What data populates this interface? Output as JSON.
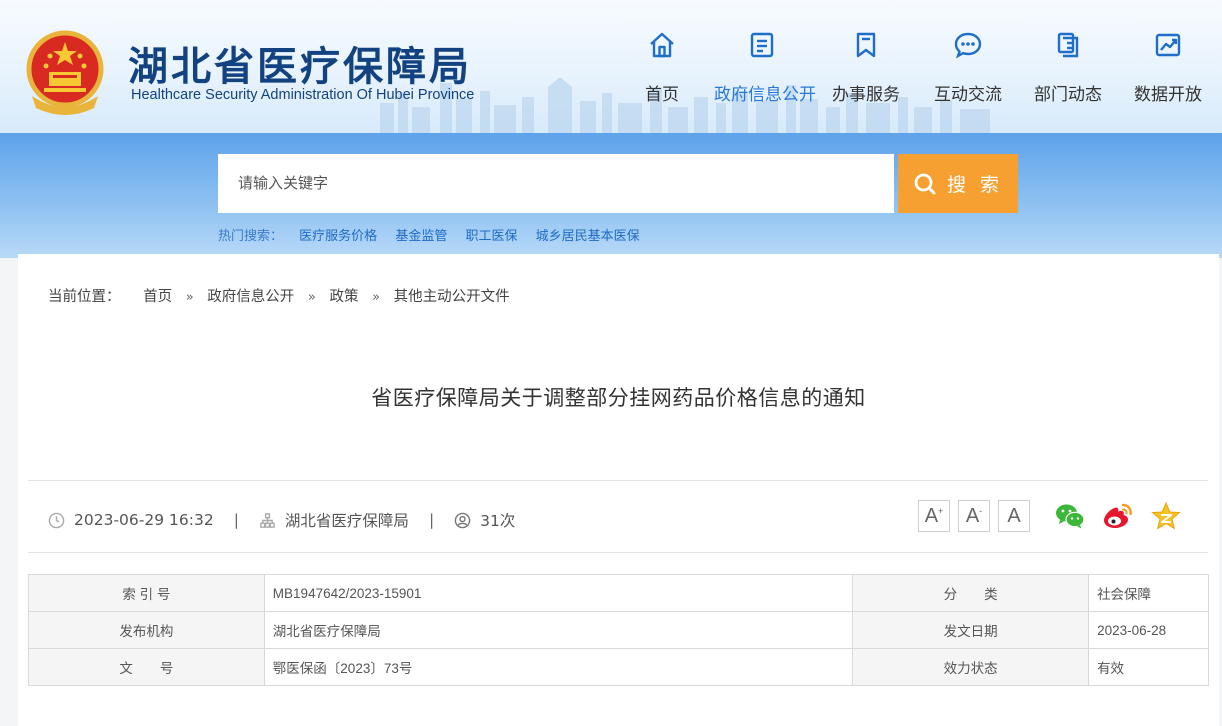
{
  "header": {
    "title": "湖北省医疗保障局",
    "subtitle": "Healthcare Security Administration Of Hubei Province",
    "nav": [
      {
        "label": "首页",
        "icon": "home-icon"
      },
      {
        "label": "政府信息公开",
        "icon": "document-icon"
      },
      {
        "label": "办事服务",
        "icon": "bookmark-icon"
      },
      {
        "label": "互动交流",
        "icon": "chat-icon"
      },
      {
        "label": "部门动态",
        "icon": "copy-icon"
      },
      {
        "label": "数据开放",
        "icon": "chart-icon"
      }
    ],
    "active_nav": "政府信息公开"
  },
  "search": {
    "placeholder": "请输入关键字",
    "button_label": "搜 索",
    "hot_label": "热门搜索：",
    "hot_terms": [
      "医疗服务价格",
      "基金监管",
      "职工医保",
      "城乡居民基本医保"
    ]
  },
  "breadcrumb": {
    "lead": "当前位置：",
    "items": [
      "首页",
      "政府信息公开",
      "政策",
      "其他主动公开文件"
    ],
    "separator": "»"
  },
  "article": {
    "title": "省医疗保障局关于调整部分挂网药品价格信息的通知",
    "datetime": "2023-06-29 16:32",
    "publisher": "湖北省医疗保障局",
    "views": "31次"
  },
  "font_size_buttons": {
    "increase": "A",
    "decrease": "A",
    "default": "A",
    "increase_sup": "+",
    "decrease_sup": "-"
  },
  "share_icons": [
    "wechat-icon",
    "weibo-icon",
    "favorite-icon"
  ],
  "info": {
    "rows": [
      {
        "k1": "索 引 号",
        "v1": "MB1947642/2023-15901",
        "k2": "分　　类",
        "v2": "社会保障"
      },
      {
        "k1": "发布机构",
        "v1": "湖北省医疗保障局",
        "k2": "发文日期",
        "v2": "2023-06-28"
      },
      {
        "k1": "文　　号",
        "v1": "鄂医保函〔2023〕73号",
        "k2": "效力状态",
        "v2": "有效"
      }
    ]
  },
  "colors": {
    "brand_blue": "#12427f",
    "nav_active": "#2779d8",
    "search_button": "#f7a032",
    "hot_link": "#1e6bc4"
  }
}
